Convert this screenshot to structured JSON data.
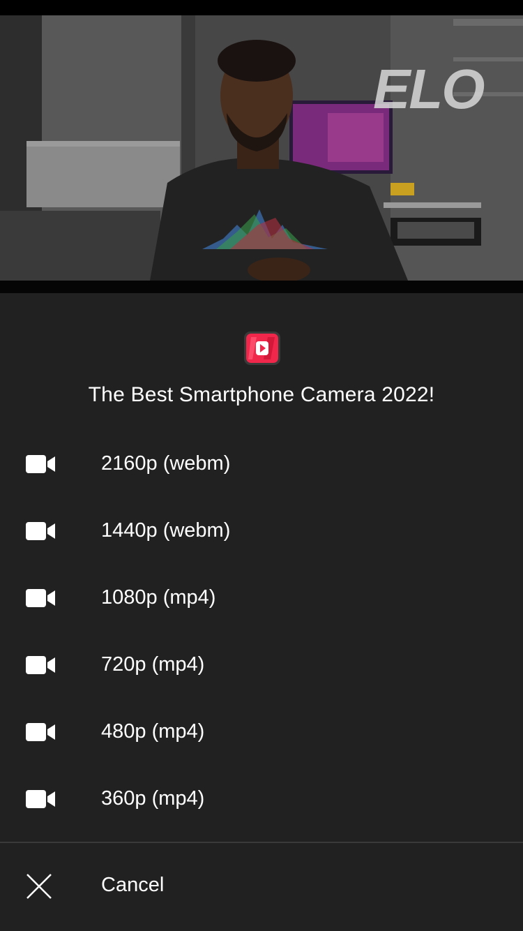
{
  "video": {
    "watermark": "ELO"
  },
  "sheet": {
    "app_icon": "video-play-app-icon",
    "title": "The Best Smartphone Camera 2022!",
    "options": [
      {
        "label": "2160p (webm)",
        "icon": "video-camera-icon"
      },
      {
        "label": "1440p (webm)",
        "icon": "video-camera-icon"
      },
      {
        "label": "1080p (mp4)",
        "icon": "video-camera-icon"
      },
      {
        "label": "720p (mp4)",
        "icon": "video-camera-icon"
      },
      {
        "label": "480p (mp4)",
        "icon": "video-camera-icon"
      },
      {
        "label": "360p (mp4)",
        "icon": "video-camera-icon"
      }
    ],
    "cancel": {
      "label": "Cancel",
      "icon": "close-icon"
    }
  },
  "colors": {
    "sheet_background": "#212121",
    "accent": "#f0264a",
    "text": "#ffffff",
    "divider": "#3a3a3a"
  }
}
